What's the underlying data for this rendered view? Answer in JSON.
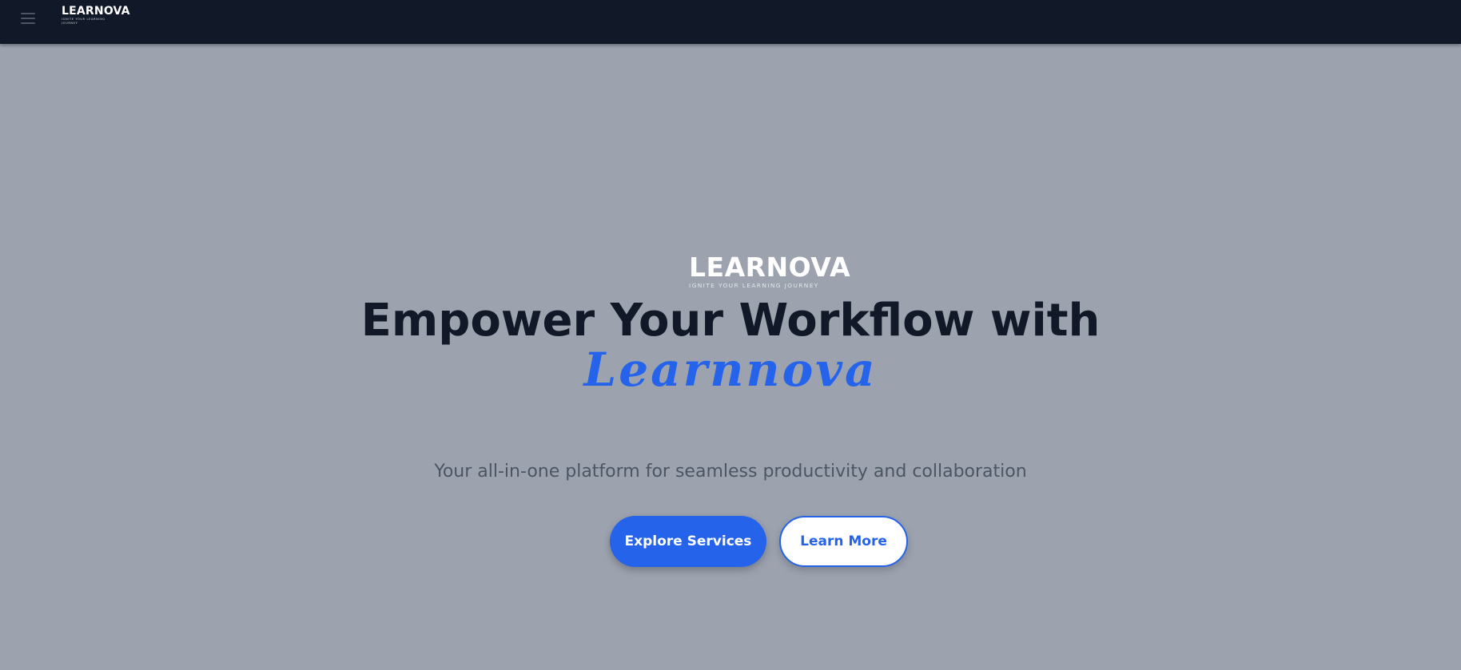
{
  "navbar": {
    "logo": {
      "wordmark": "LEARNOVA",
      "tagline": "IGNITE YOUR LEARNING JOURNEY"
    }
  },
  "hero": {
    "logo": {
      "wordmark": "LEARNOVA",
      "tagline": "IGNITE YOUR LEARNING JOURNEY"
    },
    "title": "Empower Your Workflow with",
    "brand": "Learnnova",
    "subtitle": "Your all-in-one platform for seamless productivity and collaboration",
    "primary_button": "Explore Services",
    "secondary_button": "Learn More"
  },
  "colors": {
    "navbar_bg": "#111827",
    "page_bg": "#9ca3af",
    "accent": "#2563eb",
    "title_text": "#111827",
    "subtitle_text": "#4b5563"
  },
  "icons": {
    "menu": "hamburger-menu-icon"
  }
}
